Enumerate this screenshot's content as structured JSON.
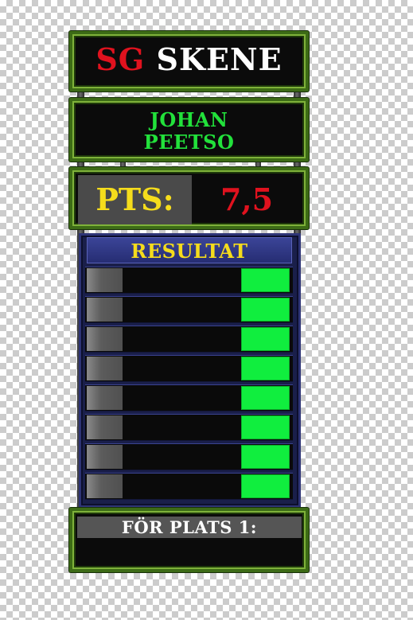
{
  "logo": {
    "part1": "SG",
    "part2": "SKENE",
    "part1_color": "#e0121e",
    "part2_color": "#ffffff"
  },
  "player": {
    "first_name": "JOHAN",
    "last_name": "PEETSO",
    "name_color": "#22e13b"
  },
  "points": {
    "label": "PTS:",
    "value": "7,5",
    "label_color": "#f5dc1c",
    "value_color": "#e0121e"
  },
  "results": {
    "title": "RESULTAT",
    "title_color": "#f5dc1c",
    "rows": [
      {
        "left": "",
        "middle": "",
        "right": ""
      },
      {
        "left": "",
        "middle": "",
        "right": ""
      },
      {
        "left": "",
        "middle": "",
        "right": ""
      },
      {
        "left": "",
        "middle": "",
        "right": ""
      },
      {
        "left": "",
        "middle": "",
        "right": ""
      },
      {
        "left": "",
        "middle": "",
        "right": ""
      },
      {
        "left": "",
        "middle": "",
        "right": ""
      },
      {
        "left": "",
        "middle": "",
        "right": ""
      }
    ],
    "right_cell_color": "#10ee3e"
  },
  "footer": {
    "label": "FÖR PLATS 1:",
    "value": ""
  },
  "colors": {
    "frame_green": "#3d6b16",
    "board_blue": "#1a1f4a"
  }
}
